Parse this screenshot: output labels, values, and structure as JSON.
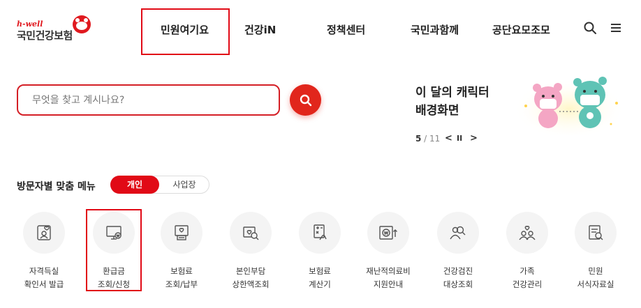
{
  "header": {
    "logo_small": "h-well",
    "logo_text": "국민건강보험",
    "nav": [
      "민원여기요",
      "건강iN",
      "정책센터",
      "국민과함께",
      "공단요모조모"
    ],
    "search_icon": "search-icon",
    "menu_icon": "hamburger-menu-icon"
  },
  "search": {
    "placeholder": "무엇을 찾고 계시나요?",
    "button_icon": "search-icon"
  },
  "promo": {
    "title_line1": "이 달의 캐릭터",
    "title_line2": "배경화면",
    "current": "5",
    "total": "11",
    "prev_label": "<",
    "pause_label": "II",
    "next_label": ">"
  },
  "visitor_menu": {
    "title": "방문자별 맞춤 메뉴",
    "tab_personal": "개인",
    "tab_business": "사업장",
    "items": [
      {
        "line1": "자격득실",
        "line2": "확인서 발급",
        "icon": "id-card-heart-icon"
      },
      {
        "line1": "환급금",
        "line2": "조회/신청",
        "icon": "monitor-won-icon"
      },
      {
        "line1": "보험료",
        "line2": "조회/납부",
        "icon": "receipt-heart-icon"
      },
      {
        "line1": "본인부담",
        "line2": "상한액조회",
        "icon": "heart-search-icon"
      },
      {
        "line1": "보험료",
        "line2": "계산기",
        "icon": "calculator-hand-icon"
      },
      {
        "line1": "재난적의료비",
        "line2": "지원안내",
        "icon": "won-support-icon"
      },
      {
        "line1": "건강검진",
        "line2": "대상조회",
        "icon": "people-search-icon"
      },
      {
        "line1": "가족",
        "line2": "건강관리",
        "icon": "family-heart-icon"
      },
      {
        "line1": "민원",
        "line2": "서식자료실",
        "icon": "document-search-icon"
      }
    ]
  },
  "colors": {
    "brand_red": "#e10a16",
    "icon_bg": "#f4f4f4",
    "icon_stroke": "#555555"
  }
}
